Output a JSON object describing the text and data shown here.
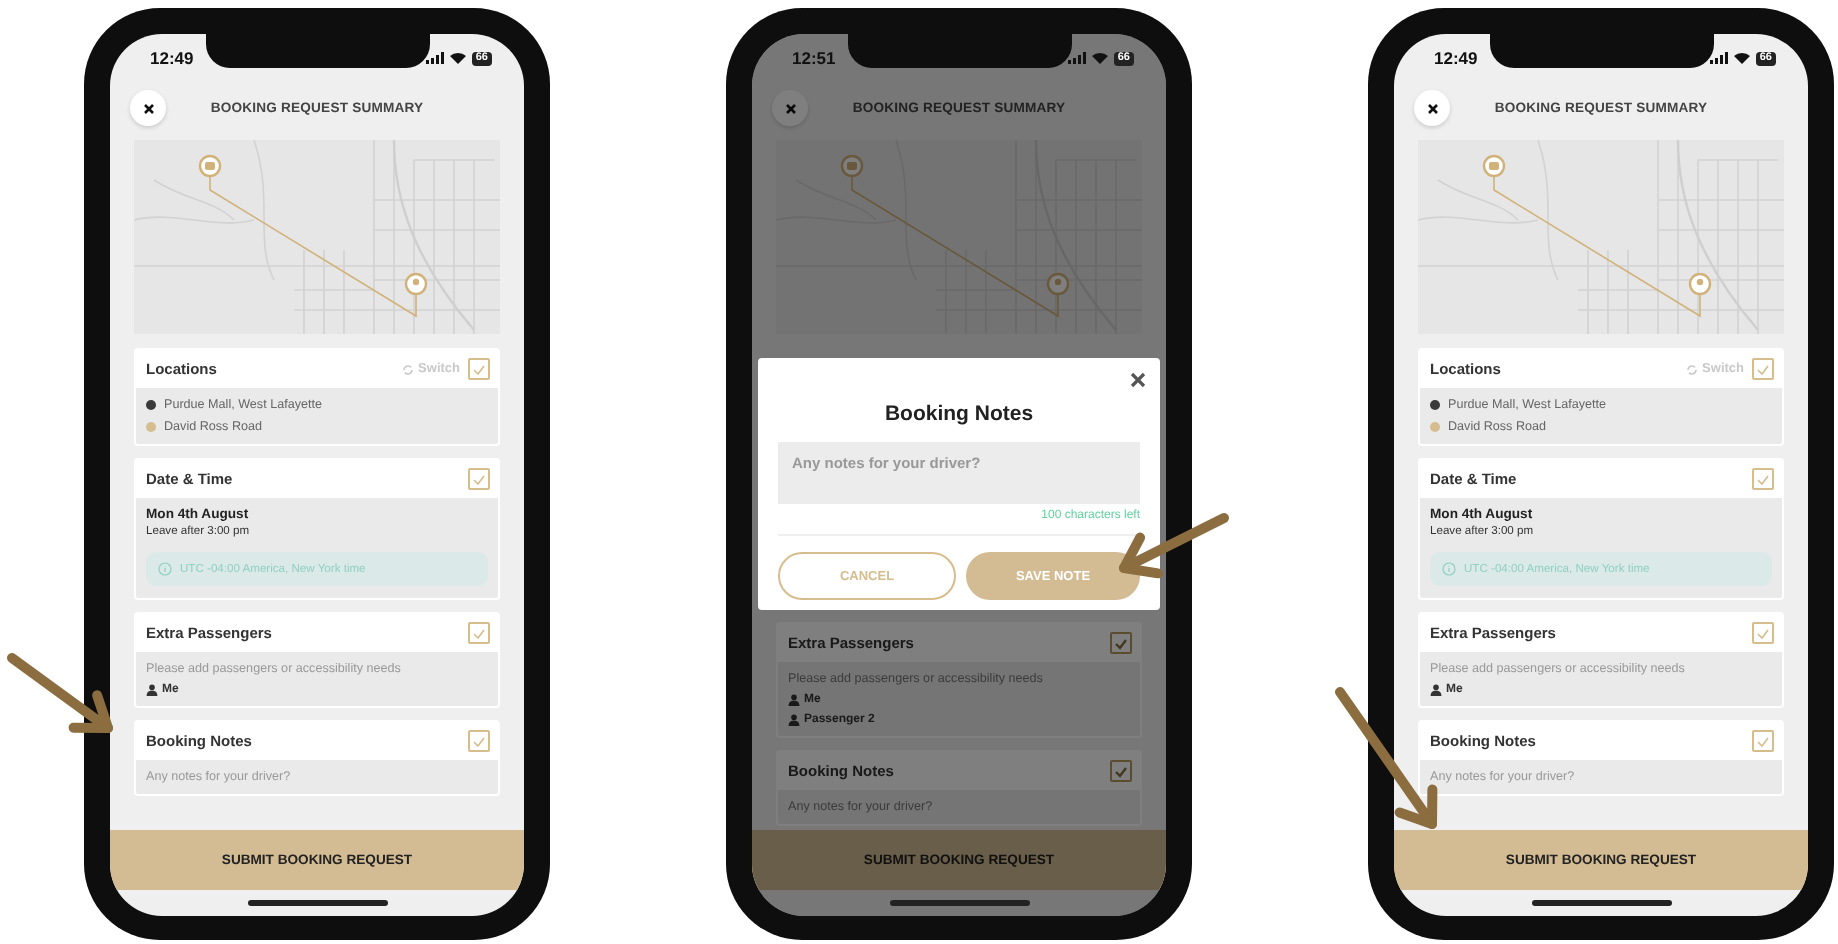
{
  "screens": [
    {
      "time": "12:49",
      "battery": "66",
      "title": "BOOKING REQUEST SUMMARY",
      "sections": [
        {
          "kind": "locations",
          "title": "Locations",
          "checked": true,
          "switch_label": "Switch",
          "stops": [
            {
              "name": "Purdue Mall, West Lafayette",
              "color": "#3a3a3a"
            },
            {
              "name": "David Ross Road",
              "color": "#d6bd8e"
            }
          ]
        },
        {
          "kind": "datetime",
          "title": "Date & Time",
          "checked": true,
          "date": "Mon 4th August",
          "time": "Leave after 3:00 pm",
          "timezone": "UTC -04:00 America, New York time"
        },
        {
          "kind": "passengers",
          "title": "Extra Passengers",
          "checked": true,
          "hint": "Please add passengers or accessibility needs",
          "people": [
            "Me"
          ]
        },
        {
          "kind": "notes",
          "title": "Booking Notes",
          "checked": true,
          "hint": "Any notes for your driver?"
        }
      ],
      "submit": "SUBMIT BOOKING REQUEST"
    },
    {
      "time": "12:51",
      "battery": "66",
      "title": "BOOKING REQUEST SUMMARY",
      "modal": {
        "title": "Booking Notes",
        "placeholder": "Any notes for your driver?",
        "counter": "100 characters left",
        "buttons": [
          "CANCEL",
          "SAVE NOTE"
        ]
      },
      "sections": [
        {
          "kind": "passengers",
          "title": "Extra Passengers",
          "checked": true,
          "hint": "Please add passengers or accessibility needs",
          "people": [
            "Me",
            "Passenger 2"
          ]
        },
        {
          "kind": "notes",
          "title": "Booking Notes",
          "checked": true,
          "hint": "Any notes for your driver?"
        }
      ],
      "submit": "SUBMIT BOOKING REQUEST"
    },
    {
      "time": "12:49",
      "battery": "66",
      "title": "BOOKING REQUEST SUMMARY",
      "sections": [
        {
          "kind": "locations",
          "title": "Locations",
          "checked": true,
          "switch_label": "Switch",
          "stops": [
            {
              "name": "Purdue Mall, West Lafayette",
              "color": "#3a3a3a"
            },
            {
              "name": "David Ross Road",
              "color": "#d6bd8e"
            }
          ]
        },
        {
          "kind": "datetime",
          "title": "Date & Time",
          "checked": true,
          "date": "Mon 4th August",
          "time": "Leave after 3:00 pm",
          "timezone": "UTC -04:00 America, New York time"
        },
        {
          "kind": "passengers",
          "title": "Extra Passengers",
          "checked": true,
          "hint": "Please add passengers or accessibility needs",
          "people": [
            "Me"
          ]
        },
        {
          "kind": "notes",
          "title": "Booking Notes",
          "checked": true,
          "hint": "Any notes for your driver?"
        }
      ],
      "submit": "SUBMIT BOOKING REQUEST"
    }
  ]
}
